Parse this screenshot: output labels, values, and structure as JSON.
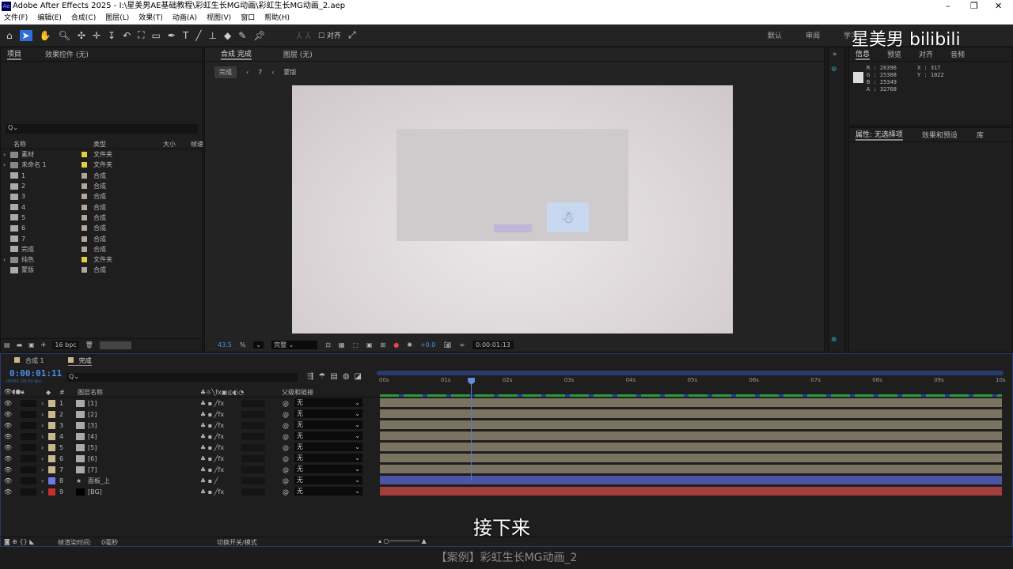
{
  "window": {
    "title": "Adobe After Effects 2025 - I:\\星美男AE基础教程\\彩虹生长MG动画\\彩虹生长MG动画_2.aep",
    "logo": "Ae"
  },
  "menu": [
    "文件(F)",
    "编辑(E)",
    "合成(C)",
    "图层(L)",
    "效果(T)",
    "动画(A)",
    "视图(V)",
    "窗口",
    "帮助(H)"
  ],
  "toolbar": {
    "align_label": "对齐",
    "workspaces": [
      "默认",
      "审阅",
      "学习"
    ]
  },
  "watermark": "星美男  bilibili",
  "project": {
    "tab": "项目",
    "effects_tab": "效果控件 (无)",
    "search_placeholder": "Q⌄",
    "columns": {
      "name": "名称",
      "type": "类型",
      "size": "大小",
      "fps": "帧速"
    },
    "items": [
      {
        "name": "素材",
        "type": "文件夹",
        "kind": "folder",
        "color": "#e0d040"
      },
      {
        "name": "未命名 1",
        "type": "文件夹",
        "kind": "folder",
        "color": "#e0d040"
      },
      {
        "name": "1",
        "type": "合成",
        "kind": "comp",
        "color": "#b0a898"
      },
      {
        "name": "2",
        "type": "合成",
        "kind": "comp",
        "color": "#b0a898"
      },
      {
        "name": "3",
        "type": "合成",
        "kind": "comp",
        "color": "#b0a898"
      },
      {
        "name": "4",
        "type": "合成",
        "kind": "comp",
        "color": "#b0a898"
      },
      {
        "name": "5",
        "type": "合成",
        "kind": "comp",
        "color": "#b0a898"
      },
      {
        "name": "6",
        "type": "合成",
        "kind": "comp",
        "color": "#b0a898"
      },
      {
        "name": "7",
        "type": "合成",
        "kind": "comp",
        "color": "#b0a898"
      },
      {
        "name": "完成",
        "type": "合成",
        "kind": "comp",
        "color": "#b0a898"
      },
      {
        "name": "纯色",
        "type": "文件夹",
        "kind": "folder",
        "color": "#e0d040"
      },
      {
        "name": "蒙版",
        "type": "合成",
        "kind": "comp",
        "color": "#b0a898"
      }
    ],
    "bpc": "16 bpc"
  },
  "comp": {
    "tab": "合成 完成",
    "layer_tab": "图层 (无)",
    "breadcrumbs": [
      "完成",
      "7",
      "蒙版"
    ],
    "zoom": "43.5",
    "zoom_unit": "%",
    "quality": "完整",
    "exposure": "+0.0",
    "timecode": "0:00:01:13"
  },
  "info": {
    "tabs": [
      "信息",
      "预览",
      "对齐",
      "音频"
    ],
    "r": "R : 26396",
    "g": "G : 25308",
    "b": "B : 25349",
    "a": "A : 32768",
    "x": "X : 317",
    "y": "Y : 1022",
    "tabs2": [
      "属性: 无选择项",
      "效果和预设",
      "库"
    ]
  },
  "timeline": {
    "tabs": [
      "合成 1",
      "完成"
    ],
    "timecode": "0:00:01:11",
    "fps": "00035 (25.00 fps)",
    "col_layer_name": "图层名称",
    "col_parent": "父级和链接",
    "col_num": "#",
    "ruler": [
      "00s",
      "01s",
      "02s",
      "03s",
      "04s",
      "05s",
      "06s",
      "07s",
      "08s",
      "09s",
      "10s"
    ],
    "playhead_seconds": 1.44,
    "layers": [
      {
        "num": "1",
        "name": "[1]",
        "color": "#c8b890",
        "parent": "无",
        "bar": "#7b7361"
      },
      {
        "num": "2",
        "name": "[2]",
        "color": "#c8b890",
        "parent": "无",
        "bar": "#7b7361"
      },
      {
        "num": "3",
        "name": "[3]",
        "color": "#c8b890",
        "parent": "无",
        "bar": "#7b7361"
      },
      {
        "num": "4",
        "name": "[4]",
        "color": "#c8b890",
        "parent": "无",
        "bar": "#7b7361"
      },
      {
        "num": "5",
        "name": "[5]",
        "color": "#c8b890",
        "parent": "无",
        "bar": "#7b7361"
      },
      {
        "num": "6",
        "name": "[6]",
        "color": "#c8b890",
        "parent": "无",
        "bar": "#7b7361"
      },
      {
        "num": "7",
        "name": "[7]",
        "color": "#c8b890",
        "parent": "无",
        "bar": "#7b7361"
      },
      {
        "num": "8",
        "name": "面板_上",
        "color": "#6a7ae8",
        "parent": "无",
        "bar": "#4b55a3"
      },
      {
        "num": "9",
        "name": "[BG]",
        "color": "#c83030",
        "parent": "无",
        "bar": "#a43d3d"
      }
    ],
    "render_time_label": "帧渲染时间:",
    "render_time": "0毫秒",
    "toggle_label": "切换开关/模式"
  },
  "subtitle": "接下来",
  "caption": "【案例】彩虹生长MG动画_2"
}
